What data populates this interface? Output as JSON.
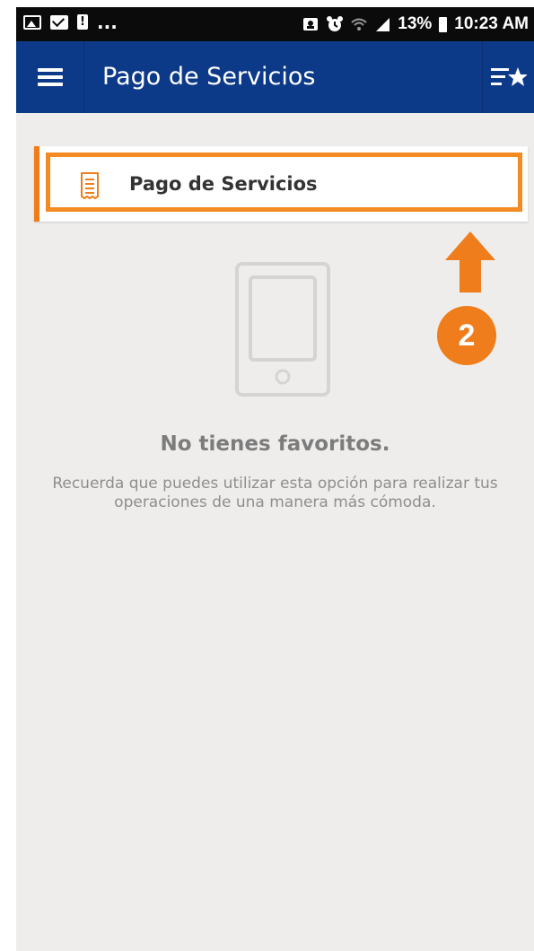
{
  "status_bar": {
    "left_icons": [
      "image-icon",
      "mail-icon",
      "alert-icon"
    ],
    "overflow": "...",
    "battery": "13%",
    "time": "10:23 AM"
  },
  "app_bar": {
    "title": "Pago de Servicios",
    "menu_icon": "hamburger-menu-icon",
    "right_icon": "favorites-list-icon"
  },
  "favorites": {
    "items": [
      {
        "label": "Pago de Servicios",
        "icon": "receipt-icon"
      }
    ]
  },
  "annotation": {
    "step_number": "2",
    "color": "#ef7d1c"
  },
  "empty_state": {
    "title": "No tienes favoritos.",
    "description": "Recuerda que puedes utilizar esta opción para realizar tus operaciones de una manera más cómoda."
  },
  "colors": {
    "app_bar": "#0d3a88",
    "accent": "#f07d1a",
    "background": "#efedeb"
  }
}
